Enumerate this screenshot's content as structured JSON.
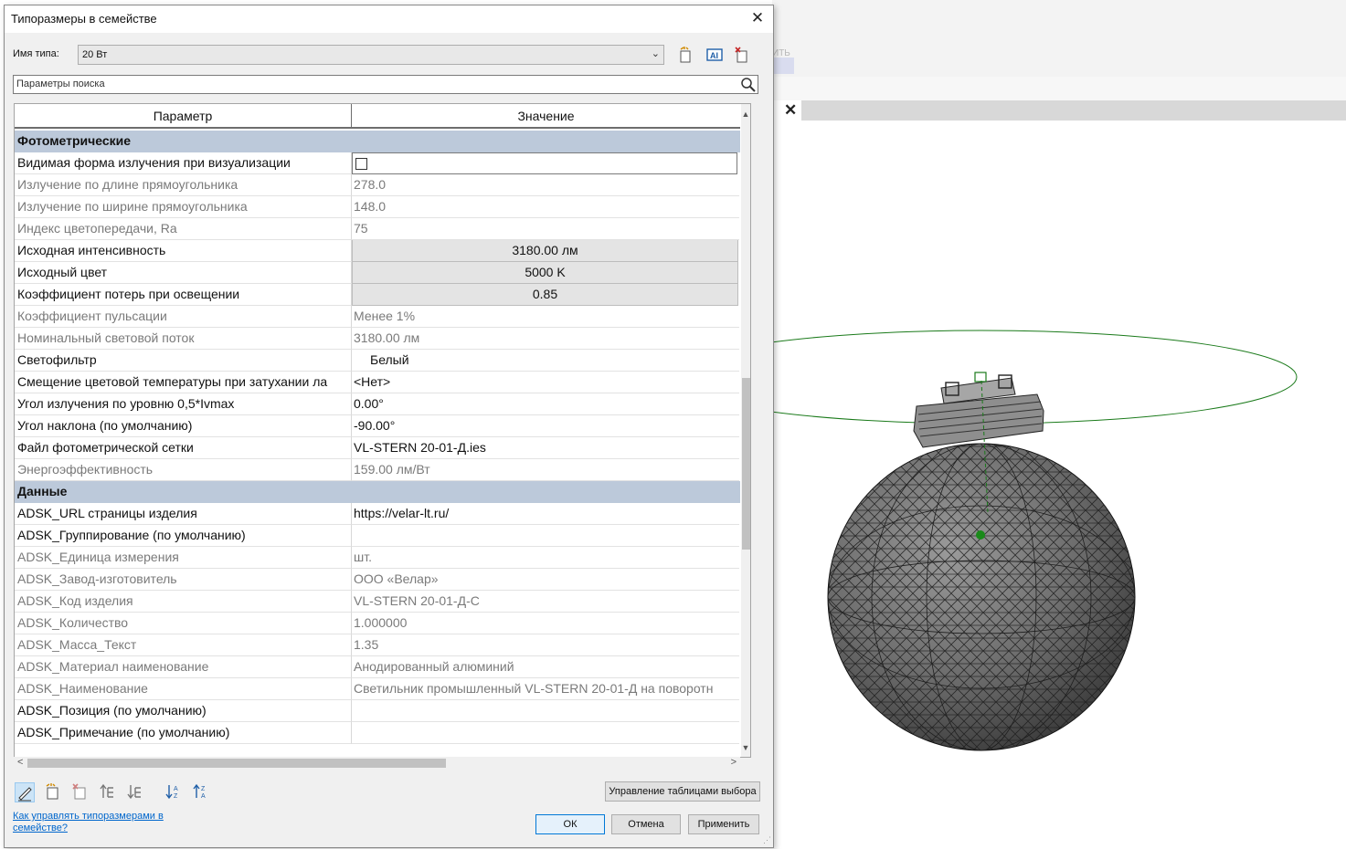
{
  "dialog": {
    "title": "Типоразмеры в семействе",
    "type_name_label": "Имя типа:",
    "type_name_value": "20 Вт",
    "search_placeholder": "Параметры поиска",
    "columns": [
      "Параметр",
      "Значение"
    ],
    "rows": [
      {
        "kind": "group",
        "name": "Фотометрические"
      },
      {
        "kind": "checkbox",
        "name": "Видимая форма излучения при визуализации",
        "checked": false
      },
      {
        "kind": "readonly",
        "name": "Излучение по длине прямоугольника",
        "value": "278.0"
      },
      {
        "kind": "readonly",
        "name": "Излучение по ширине прямоугольника",
        "value": "148.0"
      },
      {
        "kind": "readonly",
        "name": "Индекс цветопередачи, Ra",
        "value": "75"
      },
      {
        "kind": "button",
        "name": "Исходная интенсивность",
        "value": "3180.00 лм"
      },
      {
        "kind": "button",
        "name": "Исходный цвет",
        "value": "5000 K"
      },
      {
        "kind": "button",
        "name": "Коэффициент потерь при освещении",
        "value": "0.85"
      },
      {
        "kind": "readonly",
        "name": "Коэффициент пульсации",
        "value": "Менее 1%"
      },
      {
        "kind": "readonly",
        "name": "Номинальный световой поток",
        "value": "3180.00 лм"
      },
      {
        "kind": "color",
        "name": "Светофильтр",
        "value": "Белый"
      },
      {
        "kind": "editable",
        "name": "Смещение цветовой температуры при затухании ла",
        "value": "<Нет>"
      },
      {
        "kind": "editable",
        "name": "Угол излучения по уровню 0,5*Ivmax",
        "value": "0.00°"
      },
      {
        "kind": "editable",
        "name": "Угол наклона (по умолчанию)",
        "value": "-90.00°"
      },
      {
        "kind": "editable",
        "name": "Файл фотометрической сетки",
        "value": "VL-STERN 20-01-Д.ies"
      },
      {
        "kind": "readonly",
        "name": "Энергоэффективность",
        "value": "159.00 лм/Вт"
      },
      {
        "kind": "group",
        "name": "Данные"
      },
      {
        "kind": "editable",
        "name": "ADSK_URL страницы изделия",
        "value": "https://velar-lt.ru/"
      },
      {
        "kind": "editable",
        "name": "ADSK_Группирование (по умолчанию)",
        "value": ""
      },
      {
        "kind": "readonly",
        "name": "ADSK_Единица измерения",
        "value": "шт."
      },
      {
        "kind": "readonly",
        "name": "ADSK_Завод-изготовитель",
        "value": "ООО «Велар»"
      },
      {
        "kind": "readonly",
        "name": "ADSK_Код изделия",
        "value": "VL-STERN 20-01-Д-С"
      },
      {
        "kind": "readonly",
        "name": "ADSK_Количество",
        "value": "1.000000"
      },
      {
        "kind": "readonly",
        "name": "ADSK_Масса_Текст",
        "value": "1.35"
      },
      {
        "kind": "readonly",
        "name": "ADSK_Материал наименование",
        "value": "Анодированный алюминий"
      },
      {
        "kind": "readonly",
        "name": "ADSK_Наименование",
        "value": "Светильник промышленный VL-STERN 20-01-Д на поворотн"
      },
      {
        "kind": "editable",
        "name": "ADSK_Позиция (по умолчанию)",
        "value": ""
      },
      {
        "kind": "editable",
        "name": "ADSK_Примечание (по умолчанию)",
        "value": ""
      }
    ],
    "buttons": {
      "manage": "Управление таблицами выбора",
      "ok": "ОК",
      "cancel": "Отмена",
      "apply": "Применить"
    },
    "help_link": "Как управлять типоразмерами в семействе?",
    "close_glyph": "✕"
  },
  "viewport": {
    "tab_close_glyph": "✕",
    "ghost_text": "ИТЬ",
    "model_color": "#555555",
    "beam_color": "#1a7a1a"
  },
  "colors": {
    "group_header": "#bcc9da",
    "readonly_text": "#7a7a7a",
    "link": "#0066cc"
  }
}
